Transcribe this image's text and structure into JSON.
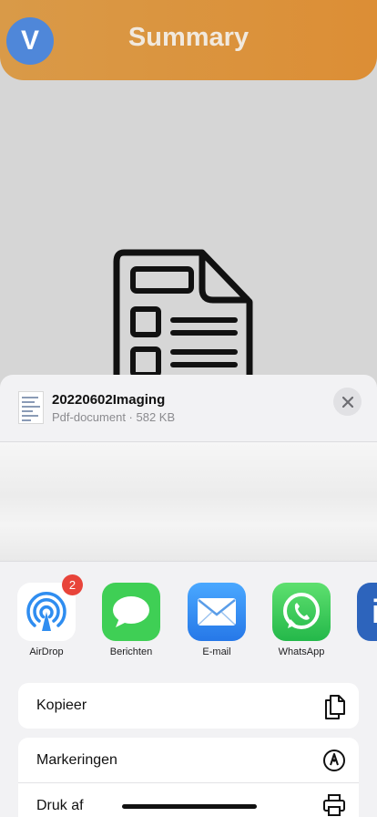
{
  "header": {
    "avatar_letter": "V",
    "title": "Summary"
  },
  "share_sheet": {
    "file": {
      "name": "20220602Imaging",
      "meta": "Pdf-document · 582 KB"
    },
    "apps": [
      {
        "label": "AirDrop",
        "icon": "airdrop-icon",
        "badge": "2"
      },
      {
        "label": "Berichten",
        "icon": "messages-icon"
      },
      {
        "label": "E-mail",
        "icon": "mail-icon"
      },
      {
        "label": "WhatsApp",
        "icon": "whatsapp-icon"
      },
      {
        "label": "Li",
        "icon": "linkedin-icon"
      }
    ],
    "actions": [
      {
        "label": "Kopieer",
        "icon": "copy-icon"
      },
      {
        "label": "Markeringen",
        "icon": "markup-icon"
      },
      {
        "label": "Druk af",
        "icon": "print-icon"
      }
    ]
  },
  "colors": {
    "header_accent": "#dc8e35",
    "avatar": "#4f87d9",
    "badge": "#e8443a",
    "messages": "#3fcf55",
    "mail": "#2f8df0",
    "whatsapp": "#2cc84d",
    "linkedin": "#2d64bc"
  }
}
